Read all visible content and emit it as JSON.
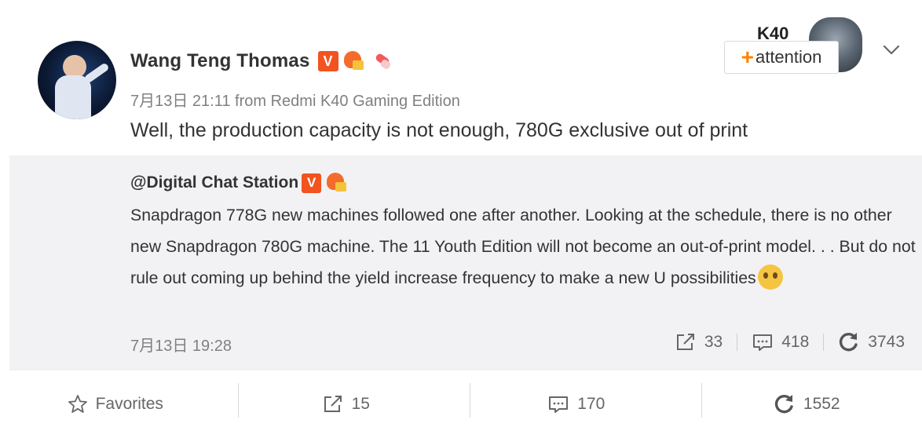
{
  "post": {
    "author": "Wang Teng Thomas",
    "verified_badge": "V",
    "meta": "7月13日 21:11 from Redmi K40 Gaming Edition",
    "content": "Well, the production capacity is not enough, 780G exclusive out of print",
    "follow": {
      "background_text": "K40",
      "plus": "+",
      "label": "attention"
    }
  },
  "repost": {
    "author": "@Digital Chat Station",
    "verified_badge": "V",
    "text": "Snapdragon 778G new machines followed one after another. Looking at the schedule, there is no other new Snapdragon 780G machine. The 11 Youth Edition will not become an out-of-print model. . . But do not rule out coming up behind the yield increase frequency to make a new U possibilities",
    "date": "7月13日 19:28",
    "shares": "33",
    "comments": "418",
    "likes": "3743"
  },
  "actions": {
    "favorites": "Favorites",
    "shares": "15",
    "comments": "170",
    "likes": "1552"
  },
  "colors": {
    "verified": "#f2531f",
    "follow_plus": "#ff8200",
    "repost_bg": "#f2f2f5"
  }
}
